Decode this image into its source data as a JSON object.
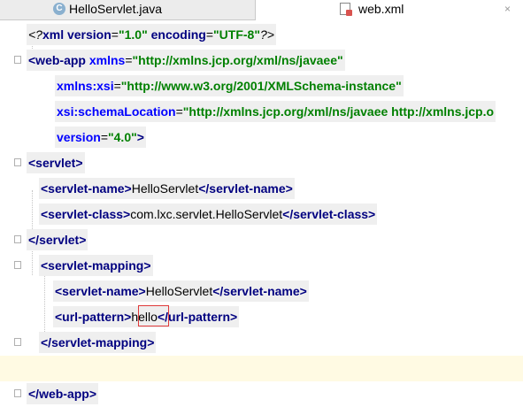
{
  "tabs": [
    {
      "label": "HelloServlet.java",
      "icon": "java-class-icon"
    },
    {
      "label": "web.xml",
      "icon": "xml-file-icon",
      "close": "×"
    }
  ],
  "code": {
    "l1": {
      "a": "<?",
      "b": "xml version",
      "c": "=",
      "d": "\"1.0\"",
      "e": " encoding",
      "f": "=",
      "g": "\"UTF-8\"",
      "h": "?>"
    },
    "l2": {
      "a": "<web-app ",
      "b": "xmlns",
      "c": "=",
      "d": "\"http://xmlns.jcp.org/xml/ns/javaee\""
    },
    "l3": {
      "a": "xmlns:xsi",
      "b": "=",
      "c": "\"http://www.w3.org/2001/XMLSchema-instance\""
    },
    "l4": {
      "a": "xsi:schemaLocation",
      "b": "=",
      "c": "\"http://xmlns.jcp.org/xml/ns/javaee http://xmlns.jcp.o"
    },
    "l5": {
      "a": "version",
      "b": "=",
      "c": "\"4.0\"",
      "d": ">"
    },
    "l6": {
      "a": "<servlet>"
    },
    "l7": {
      "a": "<servlet-name>",
      "b": "HelloServlet",
      "c": "</servlet-name>"
    },
    "l8": {
      "a": "<servlet-class>",
      "b": "com.lxc.servlet.HelloServlet",
      "c": "</servlet-class>"
    },
    "l9": {
      "a": "</servlet>"
    },
    "l10": {
      "a": "<servlet-mapping>"
    },
    "l11": {
      "a": "<servlet-name>",
      "b": "HelloServlet",
      "c": "</servlet-name>"
    },
    "l12": {
      "a": "<url-pattern>",
      "b": "hello",
      "c": "</url-pattern>"
    },
    "l13": {
      "a": "</servlet-mapping>"
    },
    "l15": {
      "a": "</web-app>"
    }
  }
}
